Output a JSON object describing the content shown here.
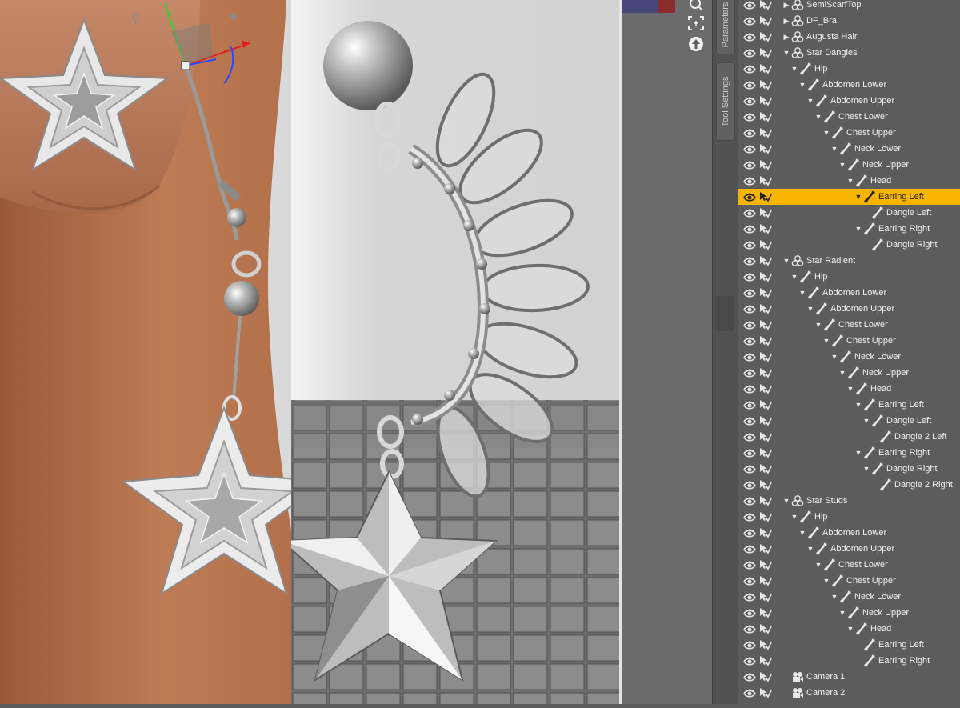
{
  "side_tabs": {
    "parameters": "Parameters",
    "tool_settings": "Tool Settings"
  },
  "scene_tree": [
    {
      "label": "SemiScarfTop",
      "depth": 0,
      "type": "figure",
      "arrow": "collapsed"
    },
    {
      "label": "DF_Bra",
      "depth": 0,
      "type": "figure",
      "arrow": "collapsed"
    },
    {
      "label": "Augusta Hair",
      "depth": 0,
      "type": "figure",
      "arrow": "collapsed"
    },
    {
      "label": "Star Dangles",
      "depth": 0,
      "type": "figure",
      "arrow": "expanded"
    },
    {
      "label": "Hip",
      "depth": 1,
      "type": "bone",
      "arrow": "expanded"
    },
    {
      "label": "Abdomen Lower",
      "depth": 2,
      "type": "bone",
      "arrow": "expanded"
    },
    {
      "label": "Abdomen Upper",
      "depth": 3,
      "type": "bone",
      "arrow": "expanded"
    },
    {
      "label": "Chest Lower",
      "depth": 4,
      "type": "bone",
      "arrow": "expanded"
    },
    {
      "label": "Chest Upper",
      "depth": 5,
      "type": "bone",
      "arrow": "expanded"
    },
    {
      "label": "Neck Lower",
      "depth": 6,
      "type": "bone",
      "arrow": "expanded"
    },
    {
      "label": "Neck Upper",
      "depth": 7,
      "type": "bone",
      "arrow": "expanded"
    },
    {
      "label": "Head",
      "depth": 8,
      "type": "bone",
      "arrow": "expanded"
    },
    {
      "label": "Earring Left",
      "depth": 9,
      "type": "bone",
      "arrow": "expanded",
      "selected": true
    },
    {
      "label": "Dangle Left",
      "depth": 10,
      "type": "bone",
      "arrow": "none"
    },
    {
      "label": "Earring Right",
      "depth": 9,
      "type": "bone",
      "arrow": "expanded"
    },
    {
      "label": "Dangle Right",
      "depth": 10,
      "type": "bone",
      "arrow": "none"
    },
    {
      "label": "Star Radient",
      "depth": 0,
      "type": "figure",
      "arrow": "expanded"
    },
    {
      "label": "Hip",
      "depth": 1,
      "type": "bone",
      "arrow": "expanded"
    },
    {
      "label": "Abdomen Lower",
      "depth": 2,
      "type": "bone",
      "arrow": "expanded"
    },
    {
      "label": "Abdomen Upper",
      "depth": 3,
      "type": "bone",
      "arrow": "expanded"
    },
    {
      "label": "Chest Lower",
      "depth": 4,
      "type": "bone",
      "arrow": "expanded"
    },
    {
      "label": "Chest Upper",
      "depth": 5,
      "type": "bone",
      "arrow": "expanded"
    },
    {
      "label": "Neck Lower",
      "depth": 6,
      "type": "bone",
      "arrow": "expanded"
    },
    {
      "label": "Neck Upper",
      "depth": 7,
      "type": "bone",
      "arrow": "expanded"
    },
    {
      "label": "Head",
      "depth": 8,
      "type": "bone",
      "arrow": "expanded"
    },
    {
      "label": "Earring Left",
      "depth": 9,
      "type": "bone",
      "arrow": "expanded"
    },
    {
      "label": "Dangle Left",
      "depth": 10,
      "type": "bone",
      "arrow": "expanded"
    },
    {
      "label": "Dangle 2 Left",
      "depth": 11,
      "type": "bone",
      "arrow": "none"
    },
    {
      "label": "Earring Right",
      "depth": 9,
      "type": "bone",
      "arrow": "expanded"
    },
    {
      "label": "Dangle Right",
      "depth": 10,
      "type": "bone",
      "arrow": "expanded"
    },
    {
      "label": "Dangle 2 Right",
      "depth": 11,
      "type": "bone",
      "arrow": "none"
    },
    {
      "label": "Star Studs",
      "depth": 0,
      "type": "figure",
      "arrow": "expanded"
    },
    {
      "label": "Hip",
      "depth": 1,
      "type": "bone",
      "arrow": "expanded"
    },
    {
      "label": "Abdomen Lower",
      "depth": 2,
      "type": "bone",
      "arrow": "expanded"
    },
    {
      "label": "Abdomen Upper",
      "depth": 3,
      "type": "bone",
      "arrow": "expanded"
    },
    {
      "label": "Chest Lower",
      "depth": 4,
      "type": "bone",
      "arrow": "expanded"
    },
    {
      "label": "Chest Upper",
      "depth": 5,
      "type": "bone",
      "arrow": "expanded"
    },
    {
      "label": "Neck Lower",
      "depth": 6,
      "type": "bone",
      "arrow": "expanded"
    },
    {
      "label": "Neck Upper",
      "depth": 7,
      "type": "bone",
      "arrow": "expanded"
    },
    {
      "label": "Head",
      "depth": 8,
      "type": "bone",
      "arrow": "expanded"
    },
    {
      "label": "Earring Left",
      "depth": 9,
      "type": "bone",
      "arrow": "none"
    },
    {
      "label": "Earring Right",
      "depth": 9,
      "type": "bone",
      "arrow": "none"
    },
    {
      "label": "Camera 1",
      "depth": 0,
      "type": "camera",
      "arrow": "none"
    },
    {
      "label": "Camera 2",
      "depth": 0,
      "type": "camera",
      "arrow": "none"
    }
  ],
  "colors": {
    "selection": "#f7b500",
    "panel": "#5c5c5c",
    "skin": "#b8774f"
  },
  "icons": {
    "visibility": "eye-icon",
    "selectable": "select-arrow-icon",
    "figure": "figure-icon",
    "bone": "bone-icon",
    "camera": "camera-icon"
  }
}
